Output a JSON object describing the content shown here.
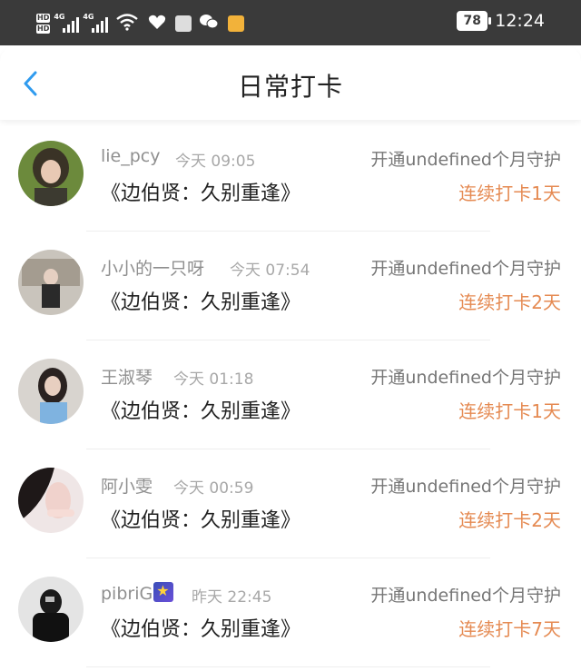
{
  "status_bar": {
    "hd_label": "HD",
    "net_1": "4G",
    "net_2": "4G",
    "wifi_label": "6",
    "battery": "78",
    "time": "12:24"
  },
  "header": {
    "title": "日常打卡"
  },
  "entries": [
    {
      "username": "lie_pcy",
      "time": "今天 09:05",
      "book": "《边伯贤：久别重逢》",
      "guard": "开通undefined个月守护",
      "streak": "连续打卡1天"
    },
    {
      "username": "小小的一只呀",
      "time": "今天 07:54",
      "book": "《边伯贤：久别重逢》",
      "guard": "开通undefined个月守护",
      "streak": "连续打卡2天"
    },
    {
      "username": "王淑琴",
      "time": "今天 01:18",
      "book": "《边伯贤：久别重逢》",
      "guard": "开通undefined个月守护",
      "streak": "连续打卡1天"
    },
    {
      "username": "阿小雯",
      "time": "今天 00:59",
      "book": "《边伯贤：久别重逢》",
      "guard": "开通undefined个月守护",
      "streak": "连续打卡2天"
    },
    {
      "username": "pibriG",
      "time": "昨天 22:45",
      "book": "《边伯贤：久别重逢》",
      "guard": "开通undefined个月守护",
      "streak": "连续打卡7天"
    }
  ],
  "colors": {
    "accent_blue": "#2f9bef",
    "streak_orange": "#e58a52",
    "status_bar": "#3a3a3a"
  }
}
